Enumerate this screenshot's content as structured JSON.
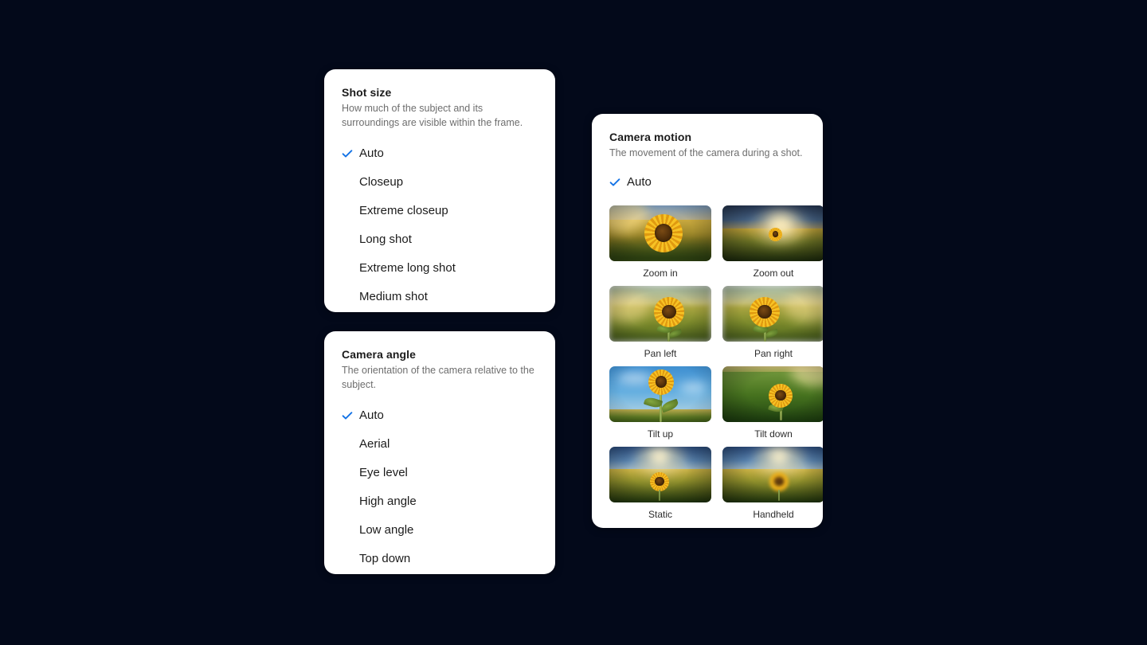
{
  "background_color": "#03091a",
  "accent_color": "#1473e6",
  "cards": {
    "shot_size": {
      "title": "Shot size",
      "description": "How much of the subject and its surroundings are visible within the frame.",
      "options": [
        {
          "label": "Auto",
          "selected": true
        },
        {
          "label": "Closeup",
          "selected": false
        },
        {
          "label": "Extreme closeup",
          "selected": false
        },
        {
          "label": "Long shot",
          "selected": false
        },
        {
          "label": "Extreme long shot",
          "selected": false
        },
        {
          "label": "Medium shot",
          "selected": false
        }
      ]
    },
    "camera_angle": {
      "title": "Camera angle",
      "description": "The orientation of the camera relative to the subject.",
      "options": [
        {
          "label": "Auto",
          "selected": true
        },
        {
          "label": "Aerial",
          "selected": false
        },
        {
          "label": "Eye level",
          "selected": false
        },
        {
          "label": "High angle",
          "selected": false
        },
        {
          "label": "Low angle",
          "selected": false
        },
        {
          "label": "Top down",
          "selected": false
        }
      ]
    },
    "camera_motion": {
      "title": "Camera motion",
      "description": "The movement of the camera during a shot.",
      "auto_option": {
        "label": "Auto",
        "selected": true
      },
      "thumbnails": [
        {
          "label": "Zoom in"
        },
        {
          "label": "Zoom out"
        },
        {
          "label": "Pan left"
        },
        {
          "label": "Pan right"
        },
        {
          "label": "Tilt up"
        },
        {
          "label": "Tilt down"
        },
        {
          "label": "Static"
        },
        {
          "label": "Handheld"
        }
      ]
    }
  },
  "icons": {
    "checkmark": "check-icon"
  }
}
